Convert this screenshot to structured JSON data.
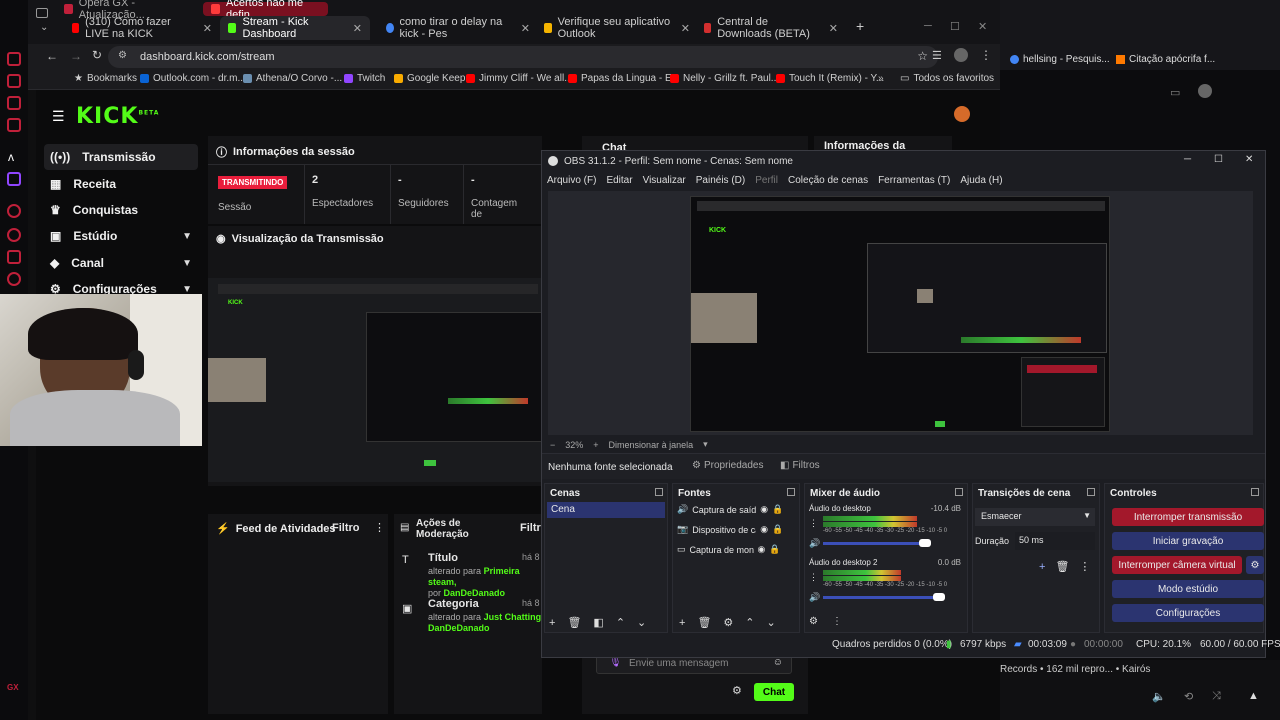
{
  "browser": {
    "tabs": [
      {
        "label": "Opera GX - Atualização..."
      },
      {
        "label": "(310) Como fazer LIVE na KICK"
      },
      {
        "label": "Stream - Kick Dashboard"
      },
      {
        "label": "como tirar o delay na kick - Pes"
      },
      {
        "label": "Verifique seu aplicativo Outlook"
      },
      {
        "label": "Central de Downloads (BETA)"
      }
    ],
    "active_tab_index": 2,
    "top_tab_partial": "Acertos não me defin",
    "url": "dashboard.kick.com/stream",
    "bookmarks": [
      "Bookmarks",
      "Outlook.com - dr.m...",
      "Athena/O Corvo -...",
      "Twitch",
      "Google Keep",
      "Jimmy Cliff - We all...",
      "Papas da Lingua - E...",
      "Nelly - Grillz ft. Paul...",
      "Touch It (Remix) - Y..."
    ],
    "all_bookmarks": "Todos os favoritos",
    "right_tabs": [
      "hellsing - Pesquis...",
      "Citação apócrifa f..."
    ],
    "accent": "#c0203a"
  },
  "kick": {
    "logo": "KICK",
    "logo_badge": "BETA",
    "brand_color": "#53fc18",
    "sidebar": [
      {
        "label": "Transmissão",
        "expandable": false
      },
      {
        "label": "Receita",
        "expandable": false
      },
      {
        "label": "Conquistas",
        "expandable": false
      },
      {
        "label": "Estúdio",
        "expandable": true
      },
      {
        "label": "Canal",
        "expandable": true
      },
      {
        "label": "Configurações",
        "expandable": true
      }
    ],
    "session": {
      "title": "Informações da sessão",
      "badge": "TRANSMITINDO",
      "badge_label": "Sessão",
      "stats": [
        {
          "value": "2",
          "label": "Espectadores"
        },
        {
          "value": "-",
          "label": "Seguidores"
        },
        {
          "value": "-",
          "label": "Contagem de"
        }
      ]
    },
    "preview_title": "Visualização da Transmissão",
    "chat_title": "Chat",
    "stream_info_title": "Informações da",
    "activity": {
      "title": "Feed de Atividades",
      "filter": "Filtro"
    },
    "moderation": {
      "title_line1": "Ações de",
      "title_line2": "Moderação",
      "filter": "Filtro",
      "items": [
        {
          "title": "Título",
          "time": "há 8",
          "text": "alterado para",
          "highlight": "Primeira steam,",
          "by": "por",
          "user": "DanDeDanado"
        },
        {
          "title": "Categoria",
          "time": "há 8",
          "text": "alterado para",
          "highlight": "Just Chatting",
          "by": "por",
          "user": "DanDeDanado"
        }
      ]
    },
    "chat_input_placeholder": "Envie uma mensagem",
    "chat_button": "Chat"
  },
  "obs": {
    "title": "OBS 31.1.2 - Perfil: Sem nome - Cenas: Sem nome",
    "menu": [
      "Arquivo (F)",
      "Editar",
      "Visualizar",
      "Painéis (D)",
      "Perfil",
      "Coleção de cenas",
      "Ferramentas (T)",
      "Ajuda (H)"
    ],
    "zoom": "32%",
    "zoom_mode": "Dimensionar à janela",
    "no_source": "Nenhuma fonte selecionada",
    "properties": "Propriedades",
    "filters": "Filtros",
    "scenes": {
      "title": "Cenas",
      "items": [
        "Cena"
      ]
    },
    "sources": {
      "title": "Fontes",
      "items": [
        "Captura de saída",
        "Dispositivo de ca",
        "Captura de moni"
      ]
    },
    "mixer": {
      "title": "Mixer de áudio",
      "channels": [
        {
          "name": "Áudio do desktop",
          "db": "-10.4 dB",
          "level": 0.72,
          "volume": 0.88
        },
        {
          "name": "Áudio do desktop 2",
          "db": "0.0 dB",
          "level": 0.6,
          "volume": 1.0
        }
      ],
      "scale": "-60 -55 -50 -45 -40 -35 -30 -25 -20 -15 -10 -5 0"
    },
    "transitions": {
      "title": "Transições de cena",
      "type": "Esmaecer",
      "duration_label": "Duração",
      "duration": "50 ms"
    },
    "controls": {
      "title": "Controles",
      "buttons": [
        "Interromper transmissão",
        "Iniciar gravação",
        "Interromper câmera virtual",
        "Modo estúdio",
        "Configurações"
      ]
    },
    "status": {
      "dropped": "Quadros perdidos 0 (0.0%)",
      "bitrate": "6797 kbps",
      "stream_time": "00:03:09",
      "rec_time": "00:00:00",
      "cpu": "CPU: 20.1%",
      "fps": "60.00 / 60.00 FPS"
    }
  },
  "media_bar": {
    "text": "Records • 162 mil repro... • Kairós"
  }
}
